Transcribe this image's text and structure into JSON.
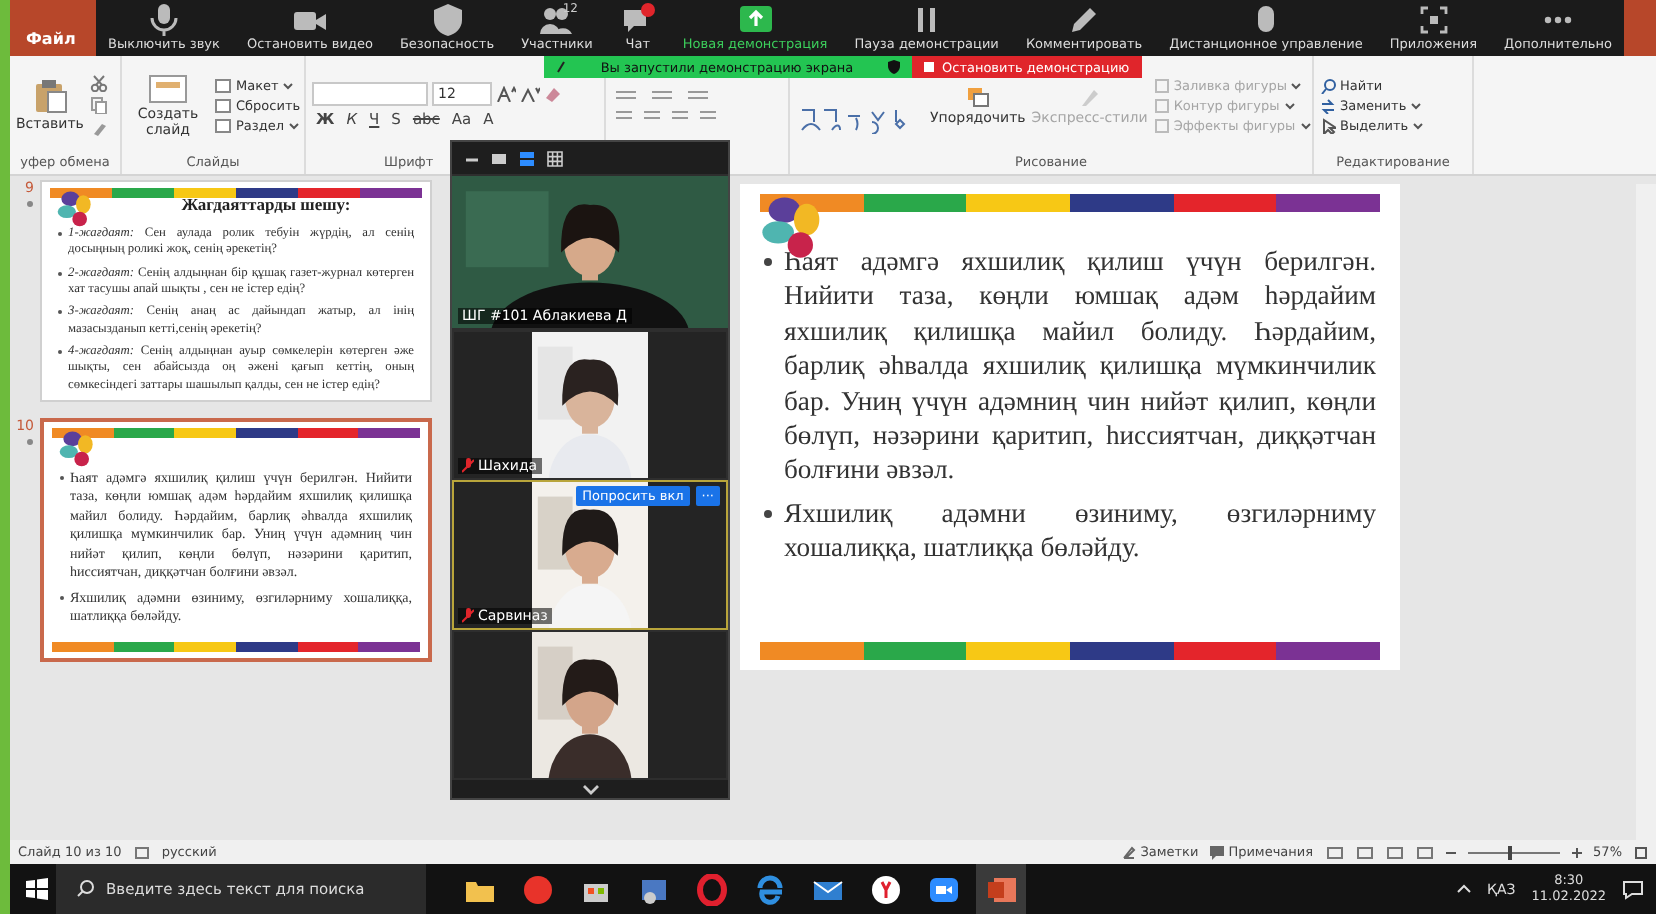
{
  "app_tab": {
    "label": "Файл"
  },
  "zoom_toolbar": {
    "items": [
      {
        "kind": "mic",
        "label": "Выключить звук"
      },
      {
        "kind": "video",
        "label": "Остановить видео"
      },
      {
        "kind": "shield",
        "label": "Безопасность"
      },
      {
        "kind": "people",
        "label": "Участники",
        "count": "12"
      },
      {
        "kind": "chat",
        "label": "Чат"
      },
      {
        "kind": "share",
        "label": "Новая демонстрация"
      },
      {
        "kind": "pause",
        "label": "Пауза демонстрации"
      },
      {
        "kind": "pen",
        "label": "Комментировать"
      },
      {
        "kind": "remote",
        "label": "Дистанционное управление"
      },
      {
        "kind": "apps",
        "label": "Приложения"
      },
      {
        "kind": "more",
        "label": "Дополнительно"
      }
    ]
  },
  "share_banner": {
    "text": "Вы запустили демонстрацию экрана",
    "stop_button": "Остановить демонстрацию"
  },
  "ribbon": {
    "clipboard": {
      "label": "уфер обмена",
      "paste": "Вставить"
    },
    "slides": {
      "label": "Слайды",
      "new_slide": "Создать слайд",
      "items": [
        "Макет",
        "Сбросить",
        "Раздел"
      ]
    },
    "font": {
      "label": "Шрифт",
      "size": "12",
      "buttons": [
        "Ж",
        "К",
        "Ч",
        "S",
        "abc",
        "Aa",
        "A"
      ]
    },
    "drawing": {
      "label": "Рисование",
      "arrange": "Упорядочить",
      "styles": {
        "label": "Экспресс-стили",
        "disabled": true
      },
      "items": [
        {
          "label": "Заливка фигуры",
          "disabled": true
        },
        {
          "label": "Контур фигуры",
          "disabled": true
        },
        {
          "label": "Эффекты фигуры",
          "disabled": true
        }
      ]
    },
    "editing": {
      "label": "Редактирование",
      "items": [
        {
          "kind": "find",
          "label": "Найти"
        },
        {
          "kind": "replace",
          "label": "Заменить"
        },
        {
          "kind": "select",
          "label": "Выделить"
        }
      ]
    }
  },
  "slides": [
    {
      "number": "9",
      "selected": false,
      "title": "Жагдаяттарды шешу:",
      "bullets": [
        "*1-жағдаят:* Сен аулада ролик тебуін жүрдің, ал сенің досыңның роликі жоқ, сенің әрекетің?",
        "*2-жағдаят:* Сенің алдыңнан бір құшақ газет-журнал көтерген хат тасушы апай шықты , сен не істер едің?",
        "*3-жағдаят:* Сенің анаң ас дайындап жатыр, ал інің мазасызданып кетті,сенің әрекетің?",
        "*4-жағдаят:* Сенің алдыңнан ауыр сөмкелерін көтерген әже шықты, сен абайсызда оң әжені қағып кеттің, оның сөмкесіндегі заттары шашылып қалды, сен не істер едің?"
      ]
    },
    {
      "number": "10",
      "selected": true,
      "bullets": [
        "Һаят адәмгә яхшилиқ қилиш үчүн берилгән. Нийити таза, көңли юмшақ адәм һәрдайим яхшилиқ қилишқа майил болиду. Һәрдайим, барлиқ әһвалда яхшилиқ қилишқа мүмкинчилик бар. Униң үчүн адәмниң чин нийәт қилип, көңли бөлүп, нәзәрини қаритип, һиссиятчан, диққәтчан болғини әвзәл.",
        "Яхшилиқ адәмни өзиниму, өзгиләрниму хошалиққа, шатлиққа бөләйду."
      ]
    }
  ],
  "video_panel": {
    "tiles": [
      {
        "kind": "wide",
        "name": "ШГ #101 Аблакиева Д",
        "muted": false,
        "highlighted": false
      },
      {
        "kind": "narrow",
        "name": "Шахида",
        "muted": true,
        "highlighted": false
      },
      {
        "kind": "narrow",
        "name": "Сарвиназ",
        "muted": true,
        "highlighted": true,
        "buttons": [
          "Попросить вкл",
          "···"
        ]
      },
      {
        "kind": "narrow",
        "highlighted": false
      }
    ]
  },
  "main_slide": {
    "bullets": [
      "Һаят адәмгә яхшилиқ қилиш үчүн берилгән. Нийити таза, көңли юмшақ адәм һәрдайим яхшилиқ қилишқа майил болиду. Һәрдайим, барлиқ әһвалда яхшилиқ қилишқа мүмкинчилик бар. Униң үчүн адәмниң чин нийәт қилип, көңли бөлүп, нәзәрини қаритип, һиссиятчан, диққәтчан болғини әвзәл.",
      "Яхшилиқ адәмни өзиниму, өзгиләрниму хошалиққа, шатлиққа бөләйду."
    ]
  },
  "status_bar": {
    "slide_info": "Слайд 10 из 10",
    "language": "русский",
    "notes": "Заметки",
    "comments": "Примечания",
    "zoom": {
      "level": 0.45,
      "reading": "57%"
    }
  },
  "taskbar": {
    "search": {
      "placeholder": "Введите здесь текст для поиска"
    },
    "language": "ҚАЗ",
    "time": "8:30",
    "date": "11.02.2022"
  }
}
